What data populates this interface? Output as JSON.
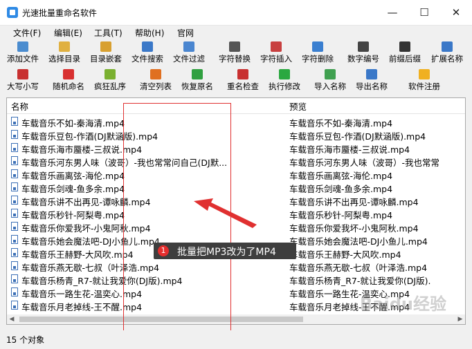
{
  "window": {
    "title": "光速批量重命名软件",
    "min_glyph": "—",
    "max_glyph": "☐",
    "close_glyph": "✕"
  },
  "menu": [
    "文件(F)",
    "编辑(E)",
    "工具(T)",
    "帮助(H)",
    "官网"
  ],
  "toolbar1": [
    {
      "label": "添加文件",
      "icon": "add-file-icon",
      "color": "#4a8ccf"
    },
    {
      "label": "选择目录",
      "icon": "folder-icon",
      "color": "#e0b040"
    },
    {
      "label": "目录嵌套",
      "icon": "nested-folder-icon",
      "color": "#d8a030"
    },
    {
      "label": "文件搜索",
      "icon": "search-icon",
      "color": "#3a78c8"
    },
    {
      "label": "文件过滤",
      "icon": "filter-icon",
      "color": "#4a86d0"
    },
    {
      "label": "字符替换",
      "icon": "replace-icon",
      "color": "#555555"
    },
    {
      "label": "字符插入",
      "icon": "insert-icon",
      "color": "#c84040"
    },
    {
      "label": "字符删除",
      "icon": "delete-char-icon",
      "color": "#3a7fd0"
    },
    {
      "label": "数字编号",
      "icon": "numbering-icon",
      "color": "#444444"
    },
    {
      "label": "前缀后缀",
      "icon": "prefix-suffix-icon",
      "color": "#333333"
    },
    {
      "label": "扩展名称",
      "icon": "extension-icon",
      "color": "#3a78c8"
    }
  ],
  "toolbar2": [
    {
      "label": "大写小写",
      "icon": "case-icon",
      "color": "#c83030"
    },
    {
      "label": "随机命名",
      "icon": "random-icon",
      "color": "#d83030"
    },
    {
      "label": "疯狂乱序",
      "icon": "shuffle-icon",
      "color": "#7ab030"
    },
    {
      "label": "清空列表",
      "icon": "clear-list-icon",
      "color": "#e07020"
    },
    {
      "label": "恢复原名",
      "icon": "undo-icon",
      "color": "#30a040"
    },
    {
      "label": "重名检查",
      "icon": "check-icon",
      "color": "#c83030"
    },
    {
      "label": "执行修改",
      "icon": "play-icon",
      "color": "#2aa840"
    },
    {
      "label": "导入名称",
      "icon": "import-icon",
      "color": "#40a050"
    },
    {
      "label": "导出名称",
      "icon": "export-icon",
      "color": "#3a78c8"
    },
    {
      "label": "软件注册",
      "icon": "star-icon",
      "color": "#f0b020"
    }
  ],
  "list": {
    "col_name": "名称",
    "col_preview": "预览",
    "rows": [
      {
        "name": "车载音乐不如-秦海清.mp4",
        "preview": "车载音乐不如-秦海清.mp4"
      },
      {
        "name": "车载音乐豆包-作酒(DJ默涵版).mp4",
        "preview": "车载音乐豆包-作酒(DJ默涵版).mp4"
      },
      {
        "name": "车载音乐海市蜃楼-三叔说.mp4",
        "preview": "车载音乐海市蜃楼-三叔说.mp4"
      },
      {
        "name": "车载音乐河东男人味（波哥）-我也常常问自己(DJ默...",
        "preview": "车载音乐河东男人味（波哥）-我也常常"
      },
      {
        "name": "车载音乐画离弦-海伦.mp4",
        "preview": "车载音乐画离弦-海伦.mp4"
      },
      {
        "name": "车载音乐剑魂-鱼多余.mp4",
        "preview": "车载音乐剑魂-鱼多余.mp4"
      },
      {
        "name": "车载音乐讲不出再见-谭咏麟.mp4",
        "preview": "车载音乐讲不出再见-谭咏麟.mp4"
      },
      {
        "name": "车载音乐秒针-阿梨粤.mp4",
        "preview": "车载音乐秒针-阿梨粤.mp4"
      },
      {
        "name": "车载音乐你爱我坏-小鬼阿秋.mp4",
        "preview": "车载音乐你爱我坏-小鬼阿秋.mp4"
      },
      {
        "name": "车载音乐她会魔法吧-DJ小鱼儿.mp4",
        "preview": "车载音乐她会魔法吧-DJ小鱼儿.mp4"
      },
      {
        "name": "车载音乐王赫野-大风吹.mp4",
        "preview": "车载音乐王赫野-大风吹.mp4"
      },
      {
        "name": "车载音乐燕无歇-七叔（叶泽浩.mp4",
        "preview": "车载音乐燕无歇-七叔（叶泽浩.mp4"
      },
      {
        "name": "车载音乐杨青_R7-就让我爱你(DJ版).mp4",
        "preview": "车载音乐杨青_R7-就让我爱你(DJ版)."
      },
      {
        "name": "车载音乐一路生花-温奕心.mp4",
        "preview": "车载音乐一路生花-温奕心.mp4"
      },
      {
        "name": "车载音乐月老掉线-王不醒.mp4",
        "preview": "车载音乐月老掉线-王不醒.mp4"
      }
    ]
  },
  "status": "15 个对象",
  "annotation": {
    "number": "1",
    "text": "批量把MP3改为了MP4"
  },
  "watermark": "Baidu经验"
}
